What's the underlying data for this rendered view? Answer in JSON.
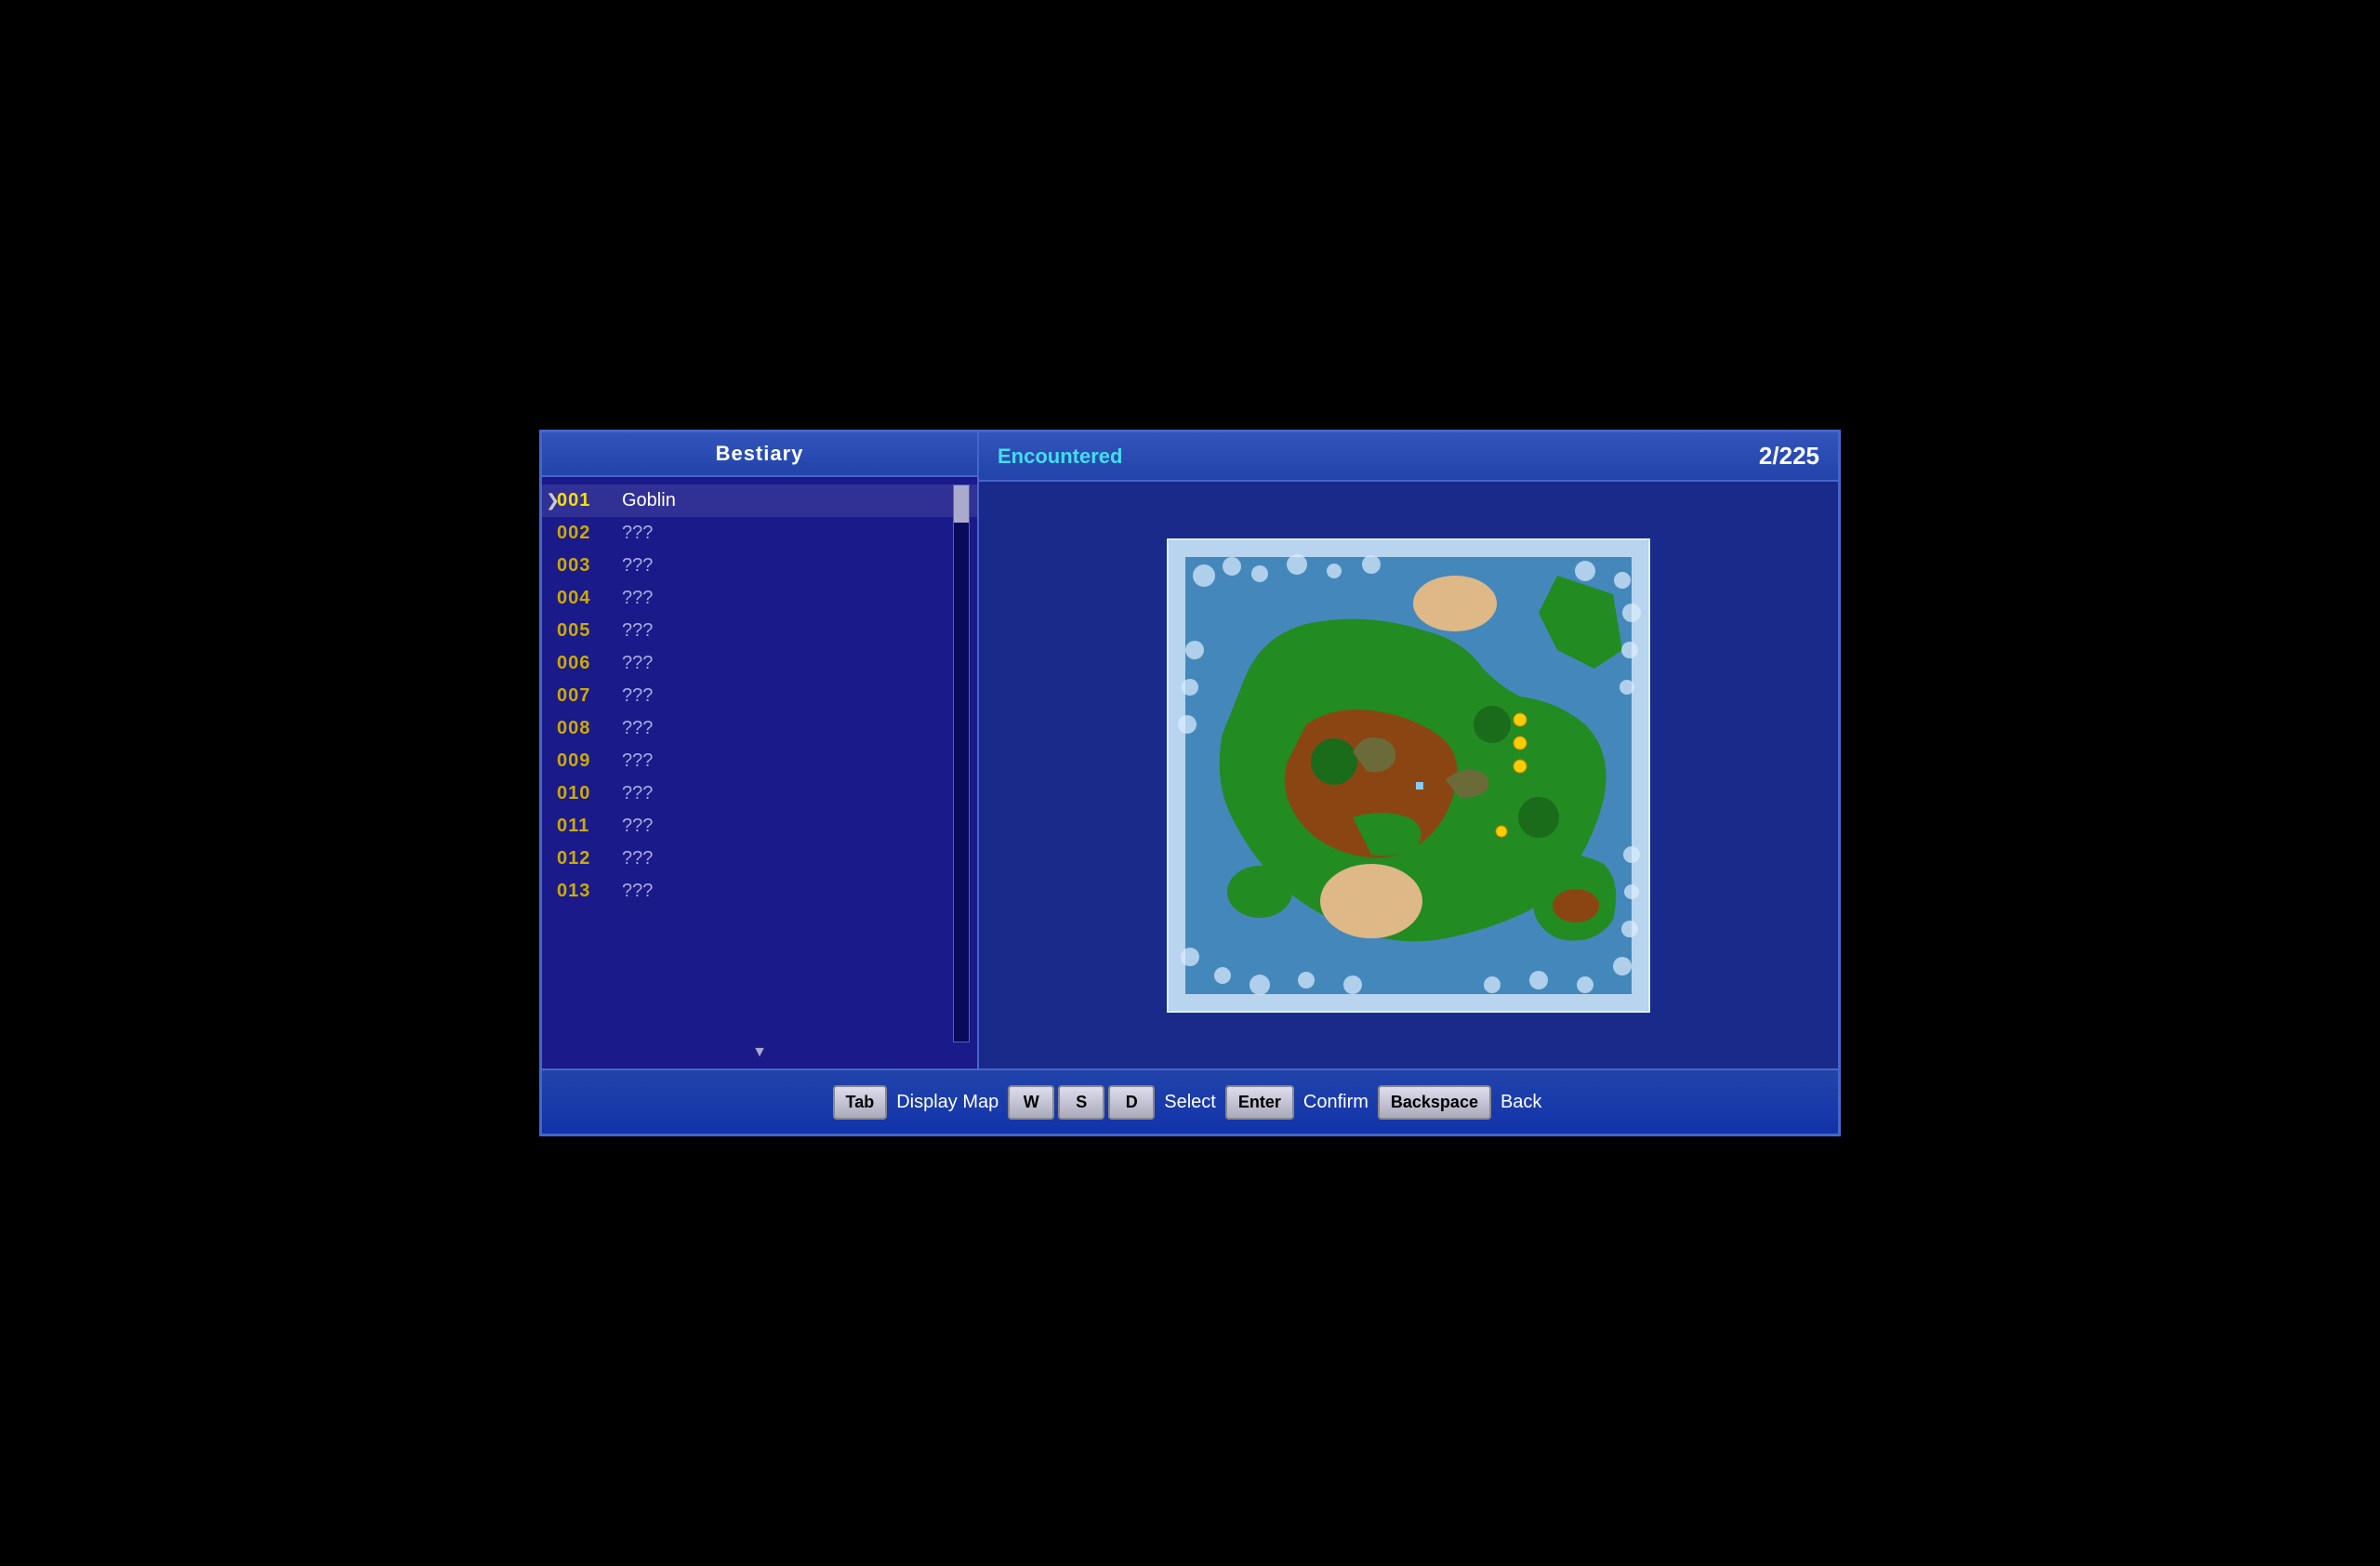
{
  "left_panel": {
    "header": "Bestiary",
    "monsters": [
      {
        "num": "001",
        "name": "Goblin",
        "known": true,
        "selected": true
      },
      {
        "num": "002",
        "name": "???",
        "known": false
      },
      {
        "num": "003",
        "name": "???",
        "known": false
      },
      {
        "num": "004",
        "name": "???",
        "known": false
      },
      {
        "num": "005",
        "name": "???",
        "known": false
      },
      {
        "num": "006",
        "name": "???",
        "known": false
      },
      {
        "num": "007",
        "name": "???",
        "known": false
      },
      {
        "num": "008",
        "name": "???",
        "known": false
      },
      {
        "num": "009",
        "name": "???",
        "known": false
      },
      {
        "num": "010",
        "name": "???",
        "known": false
      },
      {
        "num": "011",
        "name": "???",
        "known": false
      },
      {
        "num": "012",
        "name": "???",
        "known": false
      },
      {
        "num": "013",
        "name": "???",
        "known": false
      }
    ]
  },
  "right_panel": {
    "encountered_label": "Encountered",
    "count": "2/225"
  },
  "bottom_bar": {
    "buttons": [
      {
        "key": "Tab",
        "label": "Display Map"
      },
      {
        "key": "W",
        "label": ""
      },
      {
        "key": "S",
        "label": ""
      },
      {
        "key": "D",
        "label": "Select"
      },
      {
        "key": "Enter",
        "label": "Confirm"
      },
      {
        "key": "Backspace",
        "label": "Back"
      }
    ]
  },
  "colors": {
    "accent": "#4466cc",
    "bg_dark": "#0a0a5a",
    "bg_mid": "#1a1a8a",
    "header_bg": "#2244aa",
    "num_active": "#ffdd00",
    "num_inactive": "#ccaa00",
    "text_unknown": "#aaaadd",
    "encountered": "#44ddee"
  }
}
